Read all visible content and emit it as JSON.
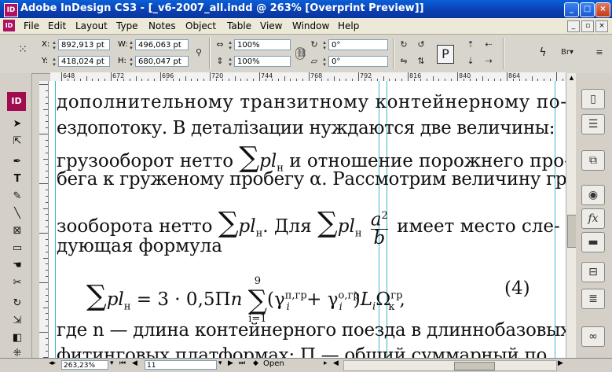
{
  "window": {
    "title": "Adobe InDesign CS3 - [_v6-2007_all.indd @ 263% [Overprint Preview]]",
    "app_icon_label": "ID"
  },
  "menu": {
    "items": [
      "File",
      "Edit",
      "Layout",
      "Type",
      "Notes",
      "Object",
      "Table",
      "View",
      "Window",
      "Help"
    ]
  },
  "control_panel": {
    "x_label": "X:",
    "x_value": "892,913 pt",
    "y_label": "Y:",
    "y_value": "418,024 pt",
    "w_label": "W:",
    "w_value": "496,063 pt",
    "h_label": "H:",
    "h_value": "680,047 pt",
    "scale_x": "100%",
    "scale_y": "100%",
    "rotate": "0°",
    "shear": "0°"
  },
  "ruler": {
    "labels": [
      "648",
      "672",
      "696",
      "720",
      "744",
      "768",
      "792",
      "816",
      "840",
      "864"
    ]
  },
  "document": {
    "line1": "дополнительному транзитному контейнерному по-",
    "line2": "ездопотоку. В деталізации нуждаются две величины:",
    "line3_a": "грузооборот нетто",
    "line3_b": "и отношение порожнего про-",
    "line4": "бега к груженому пробегу α. Рассмотрим величину гру-",
    "line5_a": "зооборота нетто",
    "line5_b": ". Для",
    "line5_c": "имеет место сле-",
    "line6": "дующая формула",
    "sigma": "∑",
    "pl": "pl",
    "sub_n": "н",
    "frac_num": "a",
    "frac_sup": "2",
    "frac_den": "b",
    "formula_eq": "= 3 · 0,5Π",
    "formula_n": "n",
    "formula_upper": "9",
    "formula_lower": "i=1",
    "formula_rest": "(γ",
    "sup_pgr": "п,гр",
    "sup_ogr": "о,гр",
    "sup_gr": "гр",
    "sub_i": "i",
    "sub_k": "к",
    "plus": " + γ",
    "close_paren": ")",
    "L": "L",
    "Omega": "Ω",
    "comma": ",",
    "eq_number": "(4)",
    "line8": "где n — длина контейнерного поезда в длиннобазовых",
    "line9": "фитинговых платформах; П — общий суммарный по"
  },
  "status": {
    "zoom": "263,23%",
    "page": "11",
    "state": "Open"
  }
}
